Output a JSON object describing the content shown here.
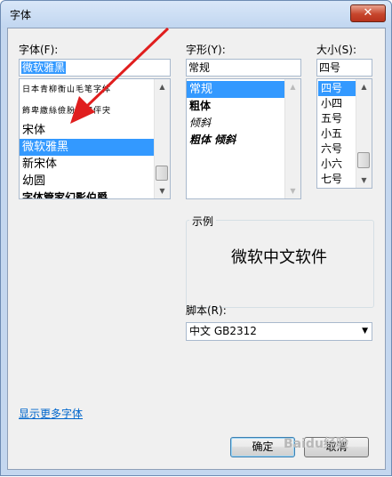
{
  "window": {
    "title": "字体",
    "close_label": "✕"
  },
  "font": {
    "label": "字体(F):",
    "value": "微软雅黑",
    "items": [
      {
        "label": "日本青柳衡山毛笔字体",
        "kind": "preview"
      },
      {
        "label": "飾卑繳絲儉朌靑字伻宊",
        "kind": "preview"
      },
      {
        "label": "宋体",
        "kind": "normal"
      },
      {
        "label": "微软雅黑",
        "kind": "selected"
      },
      {
        "label": "新宋体",
        "kind": "normal"
      },
      {
        "label": "幼圆",
        "kind": "normal"
      },
      {
        "label": "字体管家幻影伯爵",
        "kind": "bold"
      }
    ]
  },
  "style": {
    "label": "字形(Y):",
    "value": "常规",
    "items": [
      "常规",
      "粗体",
      "倾斜",
      "粗体 倾斜"
    ]
  },
  "size": {
    "label": "大小(S):",
    "value": "四号",
    "items": [
      "四号",
      "小四",
      "五号",
      "小五",
      "六号",
      "小六",
      "七号"
    ]
  },
  "sample": {
    "label": "示例",
    "text": "微软中文软件"
  },
  "script": {
    "label": "脚本(R):",
    "value": "中文 GB2312"
  },
  "more_fonts_link": "显示更多字体",
  "buttons": {
    "ok": "确定",
    "cancel": "取消"
  },
  "watermark": "Baidu经验"
}
